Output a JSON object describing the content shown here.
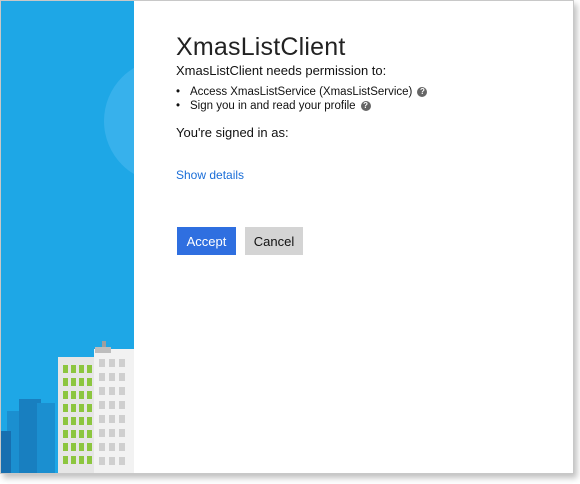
{
  "app": {
    "title": "XmasListClient",
    "permission_intro": "XmasListClient needs permission to:"
  },
  "permissions": [
    {
      "bullet": "•",
      "label": "Access XmasListService (XmasListService)",
      "help_icon": "question-circle-icon"
    },
    {
      "bullet": "•",
      "label": "Sign you in and read your profile",
      "help_icon": "question-circle-icon"
    }
  ],
  "signed_in_as": "You're signed in as:",
  "show_details_link": "Show details",
  "buttons": {
    "accept_label": "Accept",
    "cancel_label": "Cancel"
  },
  "colors": {
    "illustration_background": "#1ea7e6",
    "accept_button": "#2f6fe0",
    "cancel_button": "#d4d4d4",
    "link": "#1a6ed8"
  }
}
